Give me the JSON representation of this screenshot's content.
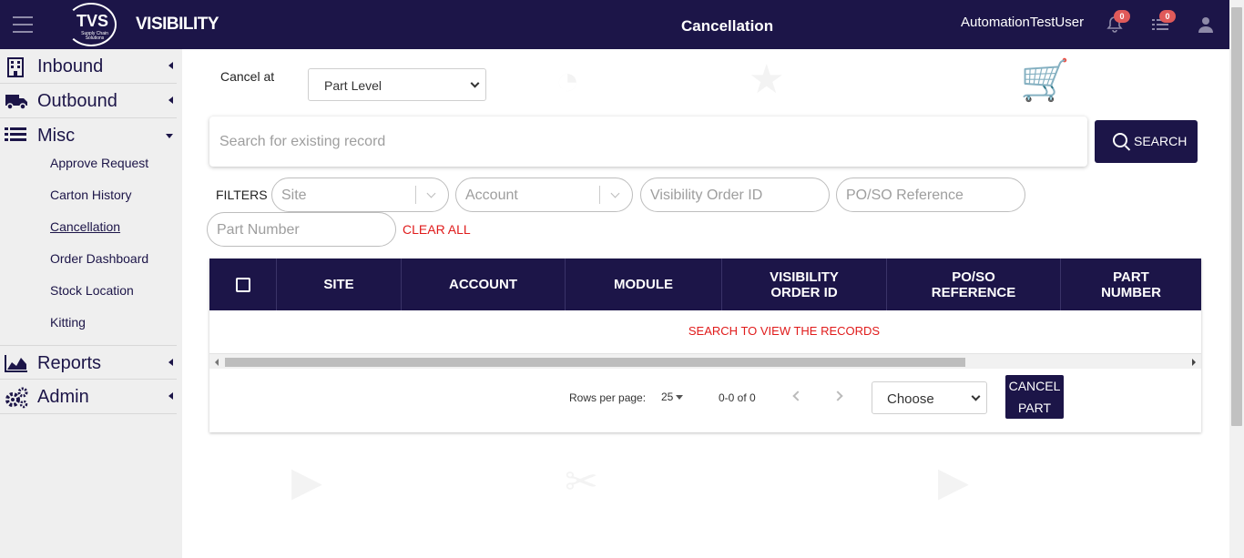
{
  "header": {
    "logo_text": "TVS",
    "logo_sub": "Supply Chain Solutions",
    "brand": "VISIBILITY",
    "title": "Cancellation",
    "user": "AutomationTestUser",
    "notifications_count": "0",
    "tasks_count": "0"
  },
  "sidebar": {
    "inbound": "Inbound",
    "outbound": "Outbound",
    "misc": "Misc",
    "misc_items": [
      "Approve Request",
      "Carton History",
      "Cancellation",
      "Order Dashboard",
      "Stock Location",
      "Kitting"
    ],
    "reports": "Reports",
    "admin": "Admin"
  },
  "main": {
    "cancel_at_label": "Cancel at",
    "cancel_at_value": "Part Level",
    "search_placeholder": "Search for existing record",
    "search_button": "SEARCH",
    "filters_label": "FILTERS",
    "filter_site": "Site",
    "filter_account": "Account",
    "filter_visibility_order_id": "Visibility Order ID",
    "filter_po_so": "PO/SO Reference",
    "filter_part_number": "Part Number",
    "clear_all": "CLEAR ALL"
  },
  "table": {
    "columns": [
      "SITE",
      "ACCOUNT",
      "MODULE",
      "VISIBILITY ORDER ID",
      "PO/SO REFERENCE",
      "PART NUMBER"
    ],
    "empty_message": "SEARCH TO VIEW THE RECORDS",
    "rows_per_page_label": "Rows per page:",
    "rows_per_page": "25",
    "range": "0-0 of 0",
    "action_select": "Choose",
    "cancel_button": "CANCEL PART"
  },
  "colors": {
    "primary": "#1c1548",
    "danger": "#e01b1b",
    "badge": "#e05a5a"
  }
}
